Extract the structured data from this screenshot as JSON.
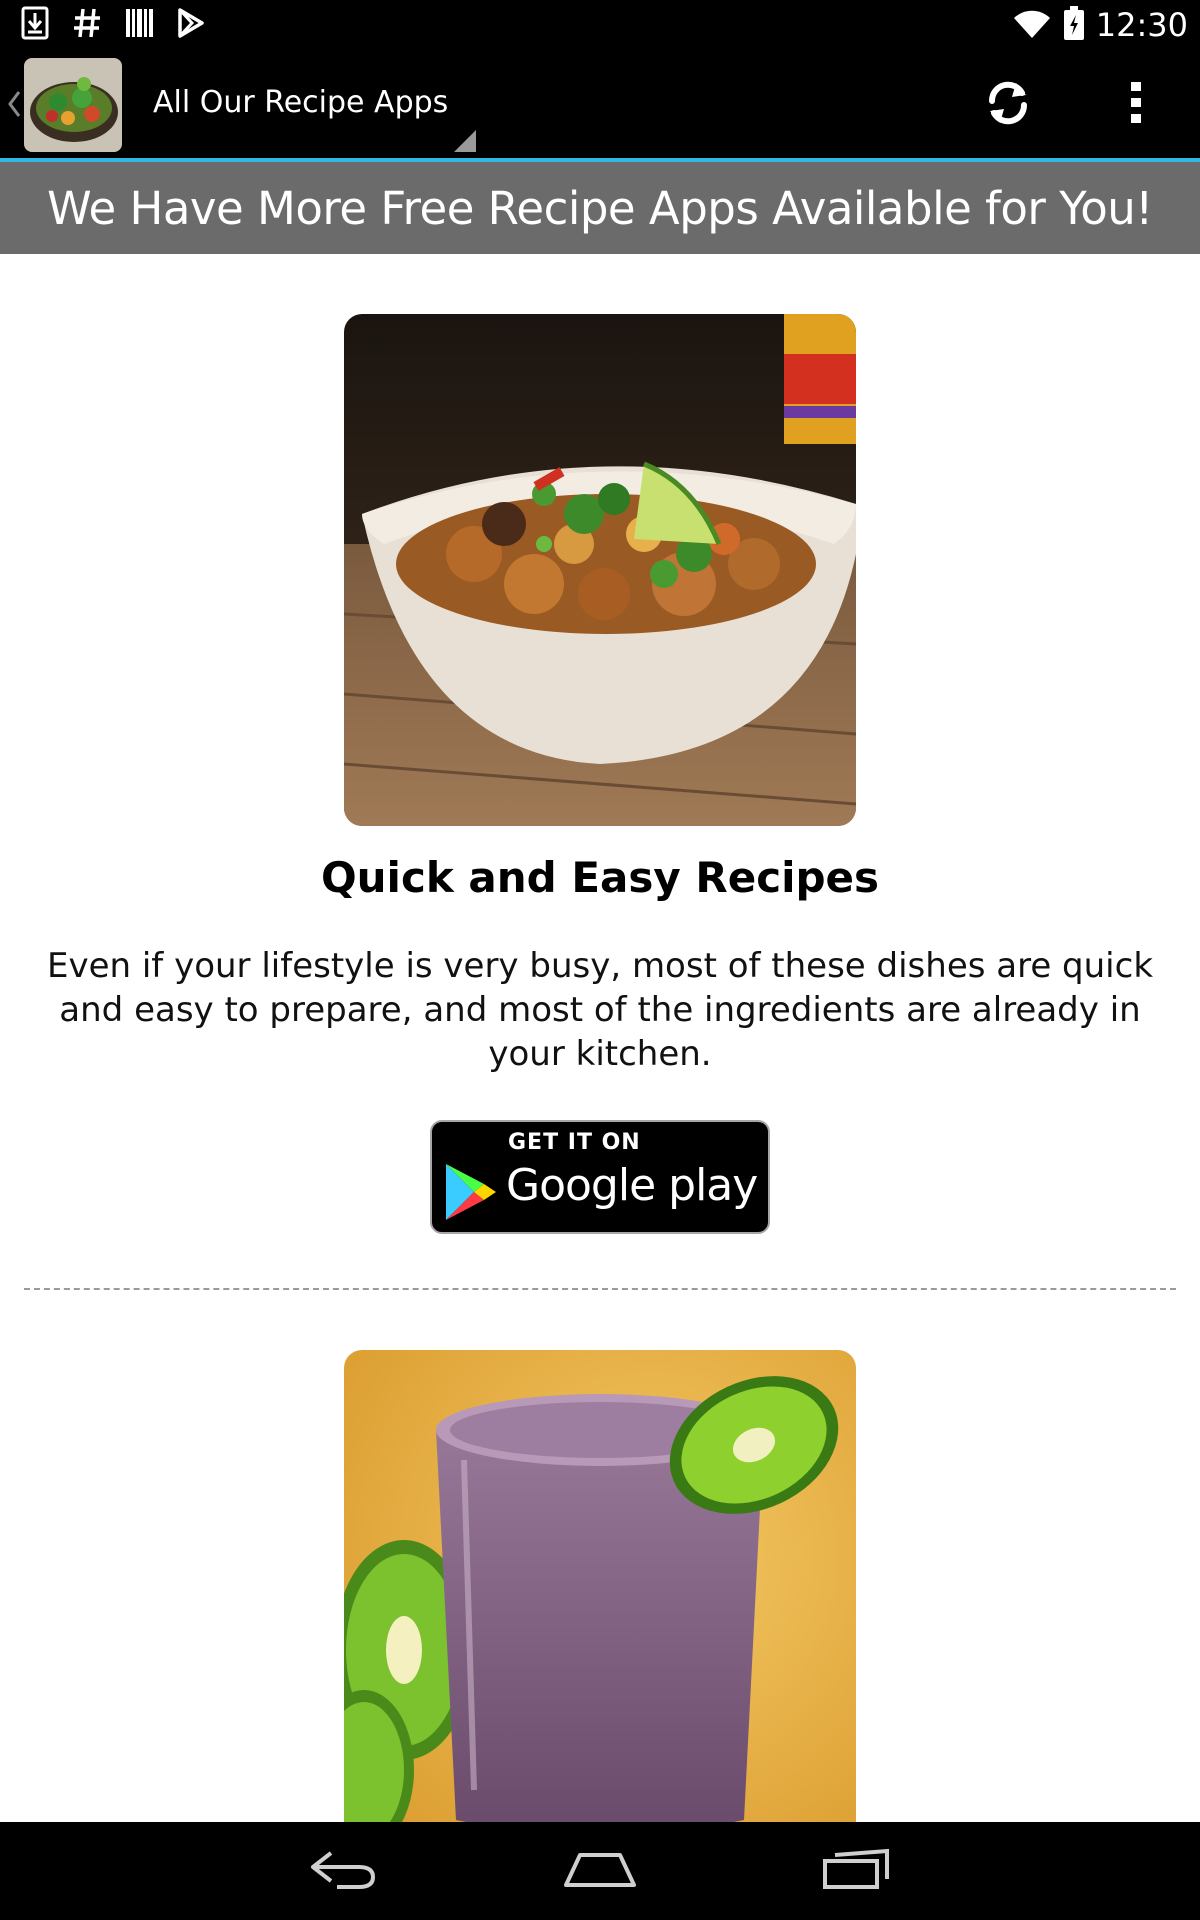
{
  "status_bar": {
    "time": "12:30",
    "left_icons": [
      "download-icon",
      "hashtag-icon",
      "barcode-icon",
      "play-store-icon"
    ],
    "right_icons": [
      "wifi-icon",
      "battery-icon"
    ]
  },
  "action_bar": {
    "title": "All Our Recipe Apps",
    "icons": [
      "up-chevron-icon",
      "app-icon",
      "spinner-triangle-icon",
      "refresh-icon",
      "overflow-menu-icon"
    ],
    "accent_color": "#33b5e5"
  },
  "banner": {
    "text": "We Have More Free Recipe Apps Available for You!"
  },
  "apps": [
    {
      "title": "Quick and Easy Recipes",
      "description": "Even if your lifestyle is very busy, most of these dishes are quick and easy to prepare, and most of the ingredients are already in your kitchen.",
      "badge_small": "GET IT ON",
      "badge_big": "Google play"
    }
  ],
  "nav_bar": {
    "icons": [
      "back-icon",
      "home-icon",
      "recents-icon"
    ]
  }
}
